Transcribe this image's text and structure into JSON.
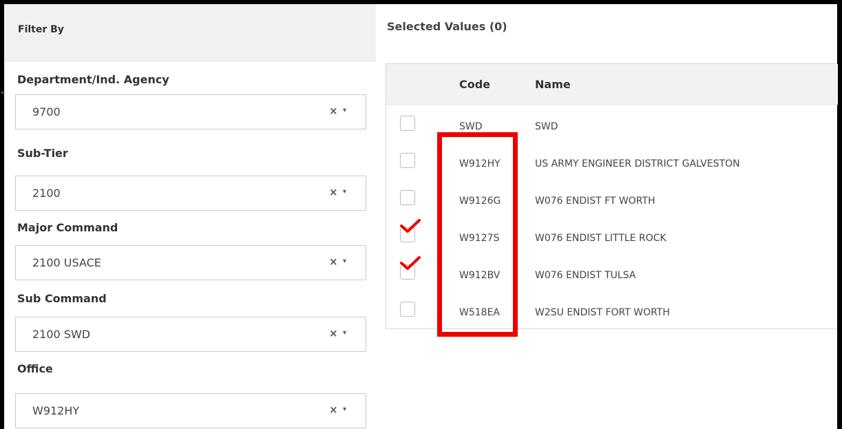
{
  "filter": {
    "title": "Filter By",
    "fields": [
      {
        "label": "Department/Ind. Agency",
        "value": "9700"
      },
      {
        "label": "Sub-Tier",
        "value": "2100"
      },
      {
        "label": "Major Command",
        "value": "2100 USACE"
      },
      {
        "label": "Sub Command",
        "value": "2100 SWD"
      },
      {
        "label": "Office",
        "value": "W912HY"
      }
    ],
    "clear_symbol": "×",
    "caret_symbol": "▾"
  },
  "selected": {
    "title": "Selected Values (0)",
    "columns": {
      "code": "Code",
      "name": "Name"
    },
    "rows": [
      {
        "code": "SWD",
        "name": "SWD",
        "checked": false
      },
      {
        "code": "W912HY",
        "name": "US ARMY ENGINEER DISTRICT GALVESTON",
        "checked": false
      },
      {
        "code": "W9126G",
        "name": "W076 ENDIST FT WORTH",
        "checked": false
      },
      {
        "code": "W9127S",
        "name": "W076 ENDIST LITTLE ROCK",
        "checked": true
      },
      {
        "code": "W912BV",
        "name": "W076 ENDIST TULSA",
        "checked": true
      },
      {
        "code": "W518EA",
        "name": "W2SU ENDIST FORT WORTH",
        "checked": false
      }
    ]
  },
  "colors": {
    "annotation_red": "#ee0000",
    "header_bg": "#f1f1f1",
    "border": "#c9c9c9"
  }
}
